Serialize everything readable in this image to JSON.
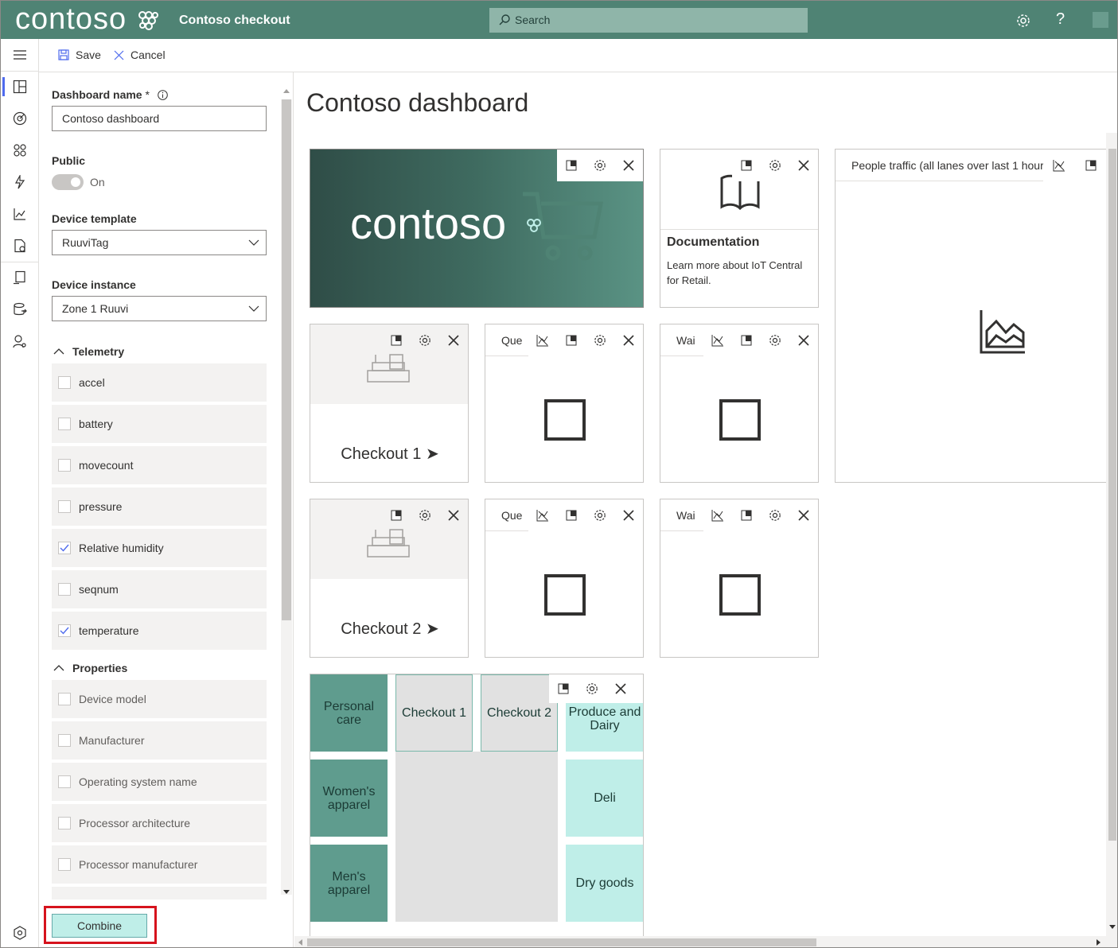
{
  "header": {
    "logo_text": "contoso",
    "app_title": "Contoso checkout",
    "search_placeholder": "Search",
    "settings_icon": "gear-icon",
    "help_label": "?"
  },
  "commands": {
    "save_label": "Save",
    "cancel_label": "Cancel"
  },
  "editor": {
    "dashboard_name_label": "Dashboard name",
    "required_marker": "*",
    "dashboard_name_value": "Contoso dashboard",
    "public_label": "Public",
    "public_toggle_text": "On",
    "device_template_label": "Device template",
    "device_template_value": "RuuviTag",
    "device_instance_label": "Device instance",
    "device_instance_value": "Zone 1 Ruuvi",
    "telemetry_heading": "Telemetry",
    "telemetry": [
      {
        "label": "accel",
        "checked": false
      },
      {
        "label": "battery",
        "checked": false
      },
      {
        "label": "movecount",
        "checked": false
      },
      {
        "label": "pressure",
        "checked": false
      },
      {
        "label": "Relative humidity",
        "checked": true
      },
      {
        "label": "seqnum",
        "checked": false
      },
      {
        "label": "temperature",
        "checked": true
      }
    ],
    "properties_heading": "Properties",
    "properties": [
      {
        "label": "Device model",
        "checked": false
      },
      {
        "label": "Manufacturer",
        "checked": false
      },
      {
        "label": "Operating system name",
        "checked": false
      },
      {
        "label": "Processor architecture",
        "checked": false
      },
      {
        "label": "Processor manufacturer",
        "checked": false
      }
    ],
    "combine_label": "Combine"
  },
  "dashboard": {
    "title": "Contoso dashboard",
    "image_tile_logo": "contoso",
    "doc_tile": {
      "title": "Documentation",
      "body": "Learn more about IoT Central for Retail."
    },
    "people_traffic_title": "People traffic (all lanes over last 1 hour)",
    "checkout1_label": "Checkout 1 ➤",
    "checkout2_label": "Checkout 2 ➤",
    "queue_title": "Que",
    "wait_title": "Wai",
    "store_map": {
      "personal_care": "Personal care",
      "checkout1": "Checkout 1",
      "checkout2": "Checkout 2",
      "produce_dairy": "Produce and Dairy",
      "womens_apparel": "Women's apparel",
      "deli": "Deli",
      "mens_apparel": "Men's apparel",
      "dry_goods": "Dry goods"
    },
    "colors": {
      "brand": "#4f8374",
      "store_dark": "#5f9c8e",
      "store_mint": "#bfeee8",
      "highlight_red": "#d6131d"
    }
  }
}
